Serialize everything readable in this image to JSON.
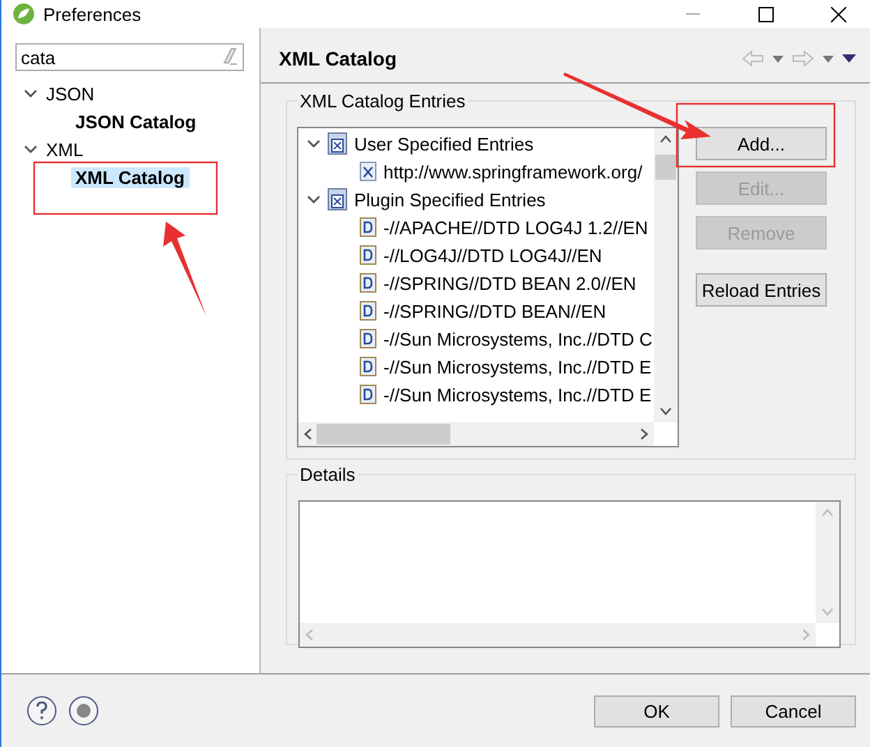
{
  "window": {
    "title": "Preferences"
  },
  "search": {
    "value": "cata"
  },
  "nav_tree": [
    {
      "label": "JSON",
      "expanded": true,
      "children": [
        {
          "label": "JSON Catalog",
          "selected": false,
          "annotated": false
        }
      ]
    },
    {
      "label": "XML",
      "expanded": true,
      "children": [
        {
          "label": "XML Catalog",
          "selected": true,
          "annotated": true
        }
      ]
    }
  ],
  "page": {
    "title": "XML Catalog"
  },
  "entries_group": {
    "title": "XML Catalog Entries",
    "tree": [
      {
        "label": "User Specified Entries",
        "expanded": true,
        "children": [
          {
            "label": "http://www.springframework.org/",
            "kind": "xml"
          }
        ]
      },
      {
        "label": "Plugin Specified Entries",
        "expanded": true,
        "children": [
          {
            "label": "-//APACHE//DTD LOG4J 1.2//EN",
            "kind": "dtd"
          },
          {
            "label": "-//LOG4J//DTD LOG4J//EN",
            "kind": "dtd"
          },
          {
            "label": "-//SPRING//DTD BEAN 2.0//EN",
            "kind": "dtd"
          },
          {
            "label": "-//SPRING//DTD BEAN//EN",
            "kind": "dtd"
          },
          {
            "label": "-//Sun Microsystems, Inc.//DTD C",
            "kind": "dtd"
          },
          {
            "label": "-//Sun Microsystems, Inc.//DTD E",
            "kind": "dtd"
          },
          {
            "label": "-//Sun Microsystems, Inc.//DTD E",
            "kind": "dtd"
          }
        ]
      }
    ],
    "buttons": [
      {
        "label": "Add...",
        "disabled": false,
        "annotated": true
      },
      {
        "label": "Edit...",
        "disabled": true,
        "annotated": false
      },
      {
        "label": "Remove",
        "disabled": true,
        "annotated": false
      },
      {
        "label": "Reload Entries",
        "disabled": false,
        "annotated": false
      }
    ]
  },
  "details_group": {
    "title": "Details"
  },
  "dialog_buttons": [
    "OK",
    "Cancel"
  ]
}
